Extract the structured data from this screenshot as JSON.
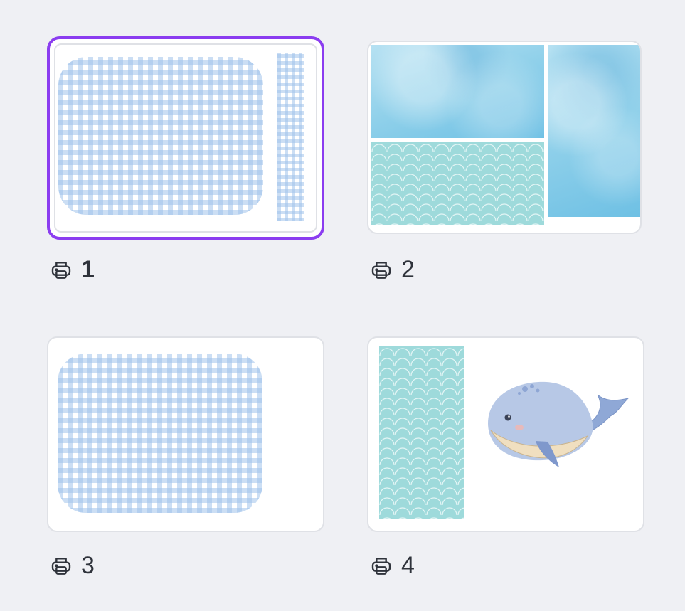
{
  "pages": [
    {
      "number": "1",
      "selected": true,
      "icon": "printer-icon"
    },
    {
      "number": "2",
      "selected": false,
      "icon": "printer-icon"
    },
    {
      "number": "3",
      "selected": false,
      "icon": "printer-icon"
    },
    {
      "number": "4",
      "selected": false,
      "icon": "printer-icon"
    }
  ],
  "colors": {
    "background": "#eff0f4",
    "selection": "#8b3df0",
    "card_border": "#dfe1e6",
    "gingham": "#a0c3eb",
    "watercolor": "#8fd0ea",
    "aqua": "#9edadb"
  }
}
